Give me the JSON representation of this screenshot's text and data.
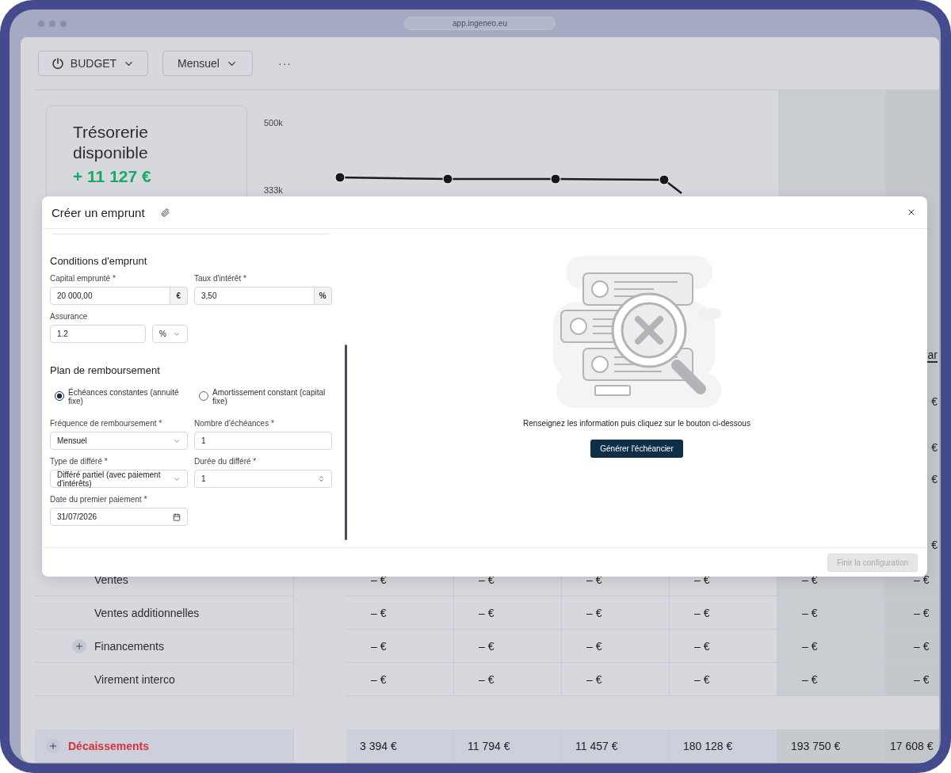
{
  "browser": {
    "url": "app.ingeneo.eu"
  },
  "toolbar": {
    "buttons": [
      {
        "label": "BUDGET",
        "kind": "icon-dropdown"
      },
      {
        "label": "Mensuel",
        "kind": "dropdown"
      }
    ],
    "more": "···"
  },
  "summary_card": {
    "title": "Trésorerie disponible",
    "value": "+ 11 127 €"
  },
  "chart": {
    "axis_labels": [
      "500k",
      "333k"
    ]
  },
  "edge_column": {
    "header": "ar",
    "values": [
      "€",
      "€",
      "€",
      "€"
    ]
  },
  "table": {
    "rows": [
      {
        "label": "Ventes",
        "kind": "item",
        "expandable": false,
        "values": [
          "– €",
          "– €",
          "– €",
          "– €",
          "– €",
          "– €"
        ]
      },
      {
        "label": "Ventes additionnelles",
        "kind": "item",
        "expandable": false,
        "values": [
          "– €",
          "– €",
          "– €",
          "– €",
          "– €",
          "– €"
        ]
      },
      {
        "label": "Financements",
        "kind": "item",
        "expandable": true,
        "values": [
          "– €",
          "– €",
          "– €",
          "– €",
          "– €",
          "– €"
        ]
      },
      {
        "label": "Virement interco",
        "kind": "item",
        "expandable": false,
        "values": [
          "– €",
          "– €",
          "– €",
          "– €",
          "– €",
          "– €"
        ]
      },
      {
        "label": "Décaissements",
        "kind": "total",
        "expandable": true,
        "values": [
          "3 394 €",
          "11 794 €",
          "11 457 €",
          "180 128 €",
          "193 750 €",
          "17 608 €"
        ]
      }
    ]
  },
  "modal": {
    "title": "Créer un emprunt",
    "sections": [
      {
        "title": "Conditions d'emprunt",
        "fields": [
          {
            "label": "Capital emprunté *",
            "kind": "unit-input",
            "value": "20 000,00",
            "unit": "€"
          },
          {
            "label": "Taux d'intérêt *",
            "kind": "unit-input",
            "value": "3,50",
            "unit": "%"
          },
          {
            "label": "Assurance",
            "kind": "unit-select",
            "value": "1.2",
            "unit": "%"
          }
        ]
      },
      {
        "title": "Plan de remboursement",
        "options": [
          {
            "label": "Échéances constantes (annuité fixe)",
            "selected": true
          },
          {
            "label": "Amortissement constant (capital fixe)",
            "selected": false
          }
        ],
        "fields": [
          {
            "label": "Fréquence de remboursement *",
            "kind": "select",
            "value": "Mensuel"
          },
          {
            "label": "Nombre d'échéances *",
            "kind": "text",
            "value": "1"
          },
          {
            "label": "Type de différé *",
            "kind": "select",
            "value": "Différé partiel (avec paiement d'intérêts)"
          },
          {
            "label": "Durée du différé *",
            "kind": "number",
            "value": "1"
          },
          {
            "label": "Date du premier paiement *",
            "kind": "date",
            "value": "31/07/2026"
          }
        ]
      }
    ],
    "empty_state": {
      "message": "Renseignez les information puis cliquez sur le bouton ci-dessous",
      "button": "Générer l'échéancier"
    },
    "footer_button": {
      "label": "Finir la configuration",
      "disabled": true
    }
  }
}
